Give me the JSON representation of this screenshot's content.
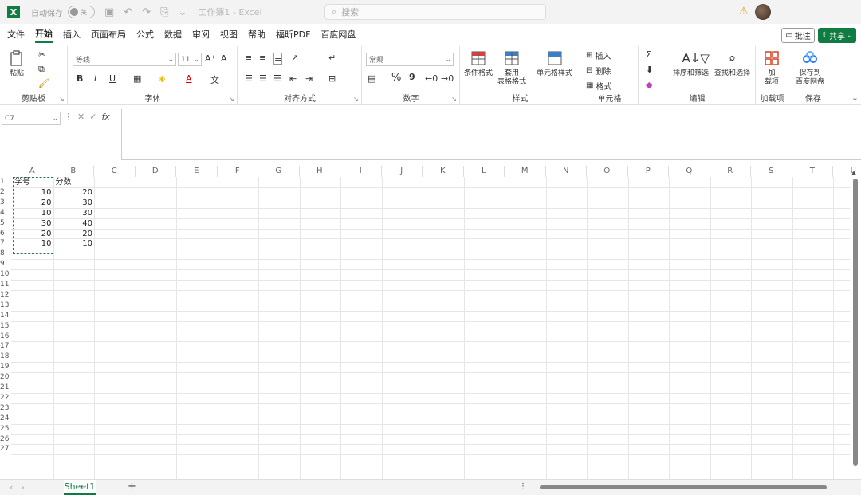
{
  "titlebar": {
    "logo": "X",
    "autosave_label": "自动保存",
    "toggle_label": "关",
    "doc_title": "工作簿1 - Excel",
    "search_placeholder": "搜索"
  },
  "menu": {
    "items": [
      "文件",
      "开始",
      "插入",
      "页面布局",
      "公式",
      "数据",
      "审阅",
      "视图",
      "帮助",
      "福昕PDF",
      "百度网盘"
    ],
    "comment_label": "批注",
    "share_label": "共享"
  },
  "ribbon": {
    "clipboard": {
      "paste": "粘贴",
      "label": "剪贴板"
    },
    "font": {
      "name": "等线",
      "size": "11",
      "label": "字体",
      "bold": "B",
      "italic": "I",
      "underline": "U"
    },
    "alignment": {
      "label": "对齐方式"
    },
    "number": {
      "format": "常规",
      "label": "数字",
      "percent": "%",
      "comma": "9"
    },
    "styles": {
      "conditional": "条件格式",
      "table1": "套用",
      "table2": "表格格式",
      "cell_styles": "单元格样式",
      "label": "样式"
    },
    "cells": {
      "insert": "插入",
      "delete": "删除",
      "format": "格式",
      "label": "单元格"
    },
    "editing": {
      "sort": "排序和筛选",
      "find": "查找和选择",
      "label": "编辑"
    },
    "addins": {
      "line1": "加",
      "line2": "载项",
      "label": "加载项"
    },
    "save": {
      "line1": "保存到",
      "line2": "百度网盘",
      "label": "保存"
    }
  },
  "formula": {
    "namebox": "C7",
    "fx": "fx"
  },
  "grid": {
    "columns": [
      "A",
      "B",
      "C",
      "D",
      "E",
      "F",
      "G",
      "H",
      "I",
      "J",
      "K",
      "L",
      "M",
      "N",
      "O",
      "P",
      "Q",
      "R",
      "S",
      "T",
      "U"
    ],
    "rows": [
      "1",
      "2",
      "3",
      "4",
      "5",
      "6",
      "7",
      "8",
      "9",
      "10",
      "11",
      "12",
      "13",
      "14",
      "15",
      "16",
      "17",
      "18",
      "19",
      "20",
      "21",
      "22",
      "23",
      "24",
      "25",
      "26",
      "27"
    ],
    "headers": [
      "学号",
      "分数"
    ],
    "data": [
      [
        "10",
        "20"
      ],
      [
        "20",
        "30"
      ],
      [
        "10",
        "30"
      ],
      [
        "30",
        "40"
      ],
      [
        "20",
        "20"
      ],
      [
        "10",
        "10"
      ]
    ]
  },
  "sheets": {
    "active": "Sheet1",
    "add": "+"
  }
}
